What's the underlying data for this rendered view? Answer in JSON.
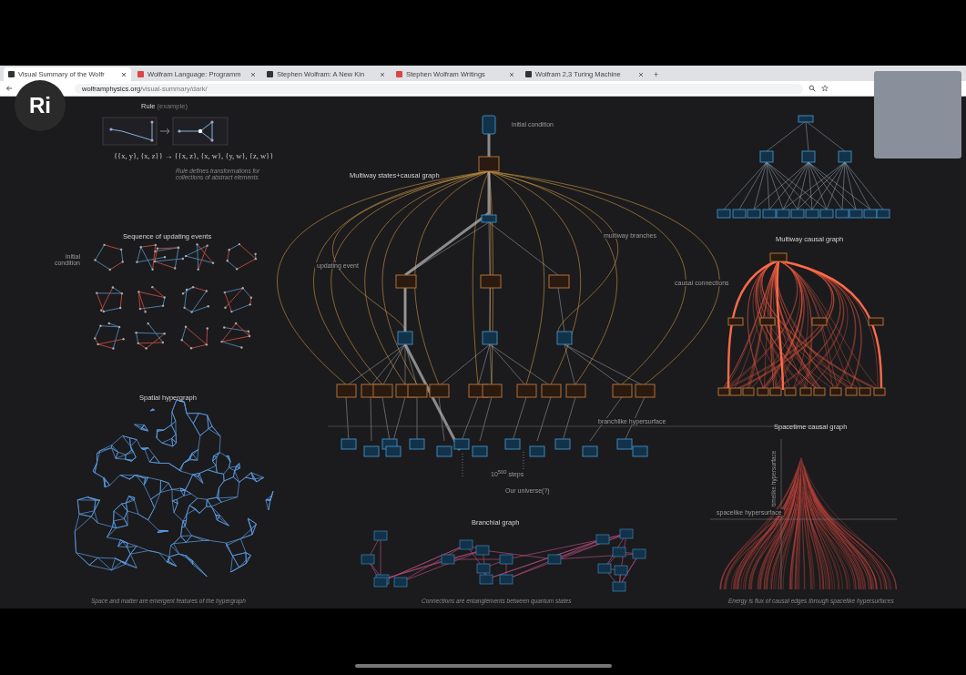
{
  "browser": {
    "tabs": [
      {
        "label": "Visual Summary of the Wolfr",
        "selected": true
      },
      {
        "label": "Wolfram Language: Programm",
        "selected": false
      },
      {
        "label": "Stephen Wolfram: A New Kin",
        "selected": false
      },
      {
        "label": "Stephen Wolfram Writings",
        "selected": false
      },
      {
        "label": "Wolfram 2,3 Turing Machine",
        "selected": false
      }
    ],
    "new_tab": "+",
    "address_host": "wolframphysics.org",
    "address_path": "/visual-summary/dark/"
  },
  "overlay_logo": "Ri",
  "page": {
    "rule": {
      "title": "Rule",
      "subtitle": "(example)",
      "formula": "{{x, y}, {x, z}} → {{x, z}, {x, w}, {y, w}, {z, w}}",
      "caption": "Rule defines transformations for collections of abstract elements"
    },
    "sequence": {
      "title": "Sequence of updating events",
      "initial_label": "initial condition"
    },
    "spatial": {
      "title": "Spatial hypergraph",
      "caption": "Space and matter are emergent features of the hypergraph"
    },
    "multiway": {
      "title": "Multiway states+causal graph",
      "initial_label": "initial condition",
      "updating_label": "updating event",
      "branches_label": "multiway branches",
      "causal_label": "causal connections",
      "hypersurface_label": "branchlike hypersurface",
      "steps_label": "10$^{500}$ steps",
      "universe_label": "Our universe(?)"
    },
    "branchial": {
      "title": "Branchial graph",
      "caption": "Connections are entanglements between quantum states"
    },
    "multiway_causal": {
      "title": "Multiway causal graph"
    },
    "spacetime": {
      "title": "Spacetime causal graph",
      "timelike_label": "timelike hypersurface",
      "spacelike_label": "spacelike hypersurface",
      "caption": "Energy is flux of causal edges through spacelike hypersurfaces"
    }
  }
}
